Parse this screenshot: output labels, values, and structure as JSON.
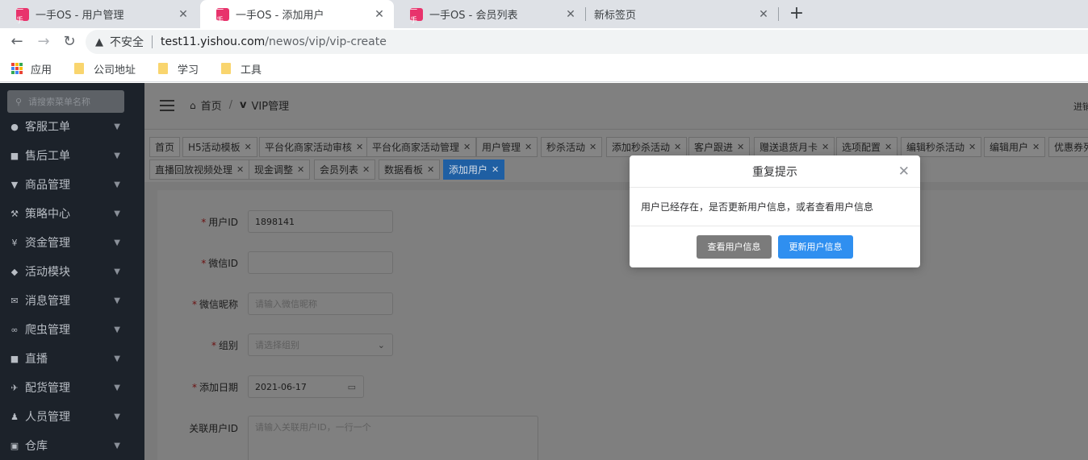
{
  "browser": {
    "tabs": [
      {
        "title": "一手OS - 用户管理",
        "active": false
      },
      {
        "title": "一手OS - 添加用户",
        "active": true
      },
      {
        "title": "一手OS - 会员列表",
        "active": false
      },
      {
        "title": "新标签页",
        "active": false
      }
    ],
    "favicon_text": "一手",
    "new_tab_label": "+",
    "address": {
      "security_label": "不安全",
      "host": "test11.yishou.com",
      "path": "/newos/vip/vip-create"
    },
    "bookmarks": [
      {
        "label": "应用",
        "icon": "apps-grid-icon"
      },
      {
        "label": "公司地址",
        "icon": "folder-icon"
      },
      {
        "label": "学习",
        "icon": "folder-icon"
      },
      {
        "label": "工具",
        "icon": "folder-icon"
      }
    ]
  },
  "sidebar": {
    "search_placeholder": "请搜索菜单名称",
    "items": [
      {
        "label": "客服工单",
        "icon": "users-icon"
      },
      {
        "label": "售后工单",
        "icon": "ticket-icon"
      },
      {
        "label": "商品管理",
        "icon": "shirt-icon"
      },
      {
        "label": "策略中心",
        "icon": "hammer-icon"
      },
      {
        "label": "资金管理",
        "icon": "yen-icon"
      },
      {
        "label": "活动模块",
        "icon": "gamepad-icon"
      },
      {
        "label": "消息管理",
        "icon": "mail-icon"
      },
      {
        "label": "爬虫管理",
        "icon": "spider-icon"
      },
      {
        "label": "直播",
        "icon": "video-icon"
      },
      {
        "label": "配货管理",
        "icon": "plane-icon"
      },
      {
        "label": "人员管理",
        "icon": "person-icon"
      },
      {
        "label": "仓库",
        "icon": "lock-icon"
      }
    ]
  },
  "header": {
    "breadcrumb_home": "首页",
    "breadcrumb_current": "VIP管理",
    "top_right_text": "进销存"
  },
  "tags": [
    {
      "label": "首页",
      "closable": false
    },
    {
      "label": "H5活动模板",
      "closable": true
    },
    {
      "label": "平台化商家活动审核",
      "closable": true
    },
    {
      "label": "平台化商家活动管理",
      "closable": true
    },
    {
      "label": "用户管理",
      "closable": true
    },
    {
      "label": "秒杀活动",
      "closable": true
    },
    {
      "label": "添加秒杀活动",
      "closable": true
    },
    {
      "label": "客户跟进",
      "closable": true
    },
    {
      "label": "赠送退货月卡",
      "closable": true
    },
    {
      "label": "选项配置",
      "closable": true
    },
    {
      "label": "编辑秒杀活动",
      "closable": true
    },
    {
      "label": "编辑用户",
      "closable": true
    },
    {
      "label": "优惠券列",
      "closable": false
    },
    {
      "label": "直播回放视频处理",
      "closable": true
    },
    {
      "label": "现金调整",
      "closable": true
    },
    {
      "label": "会员列表",
      "closable": true
    },
    {
      "label": "数据看板",
      "closable": true
    },
    {
      "label": "添加用户",
      "closable": true,
      "active": true
    }
  ],
  "form": {
    "fields": [
      {
        "label": "用户ID",
        "required": true,
        "value": "1898141",
        "placeholder": ""
      },
      {
        "label": "微信ID",
        "required": true,
        "value": "",
        "placeholder": ""
      },
      {
        "label": "微信昵称",
        "required": true,
        "value": "",
        "placeholder": "请输入微信昵称"
      },
      {
        "label": "组别",
        "required": true,
        "value": "",
        "placeholder": "请选择组别"
      },
      {
        "label": "添加日期",
        "required": true,
        "value": "2021-06-17",
        "placeholder": ""
      },
      {
        "label": "关联用户ID",
        "required": false,
        "value": "",
        "placeholder": "请输入关联用户ID，一行一个"
      }
    ]
  },
  "dialog": {
    "title": "重复提示",
    "message": "用户已经存在，是否更新用户信息，或者查看用户信息",
    "view_button": "查看用户信息",
    "update_button": "更新用户信息"
  },
  "colors": {
    "primary": "#2f8ff0",
    "sidebar_bg": "#1c222a",
    "required_mark": "#6b1010"
  }
}
